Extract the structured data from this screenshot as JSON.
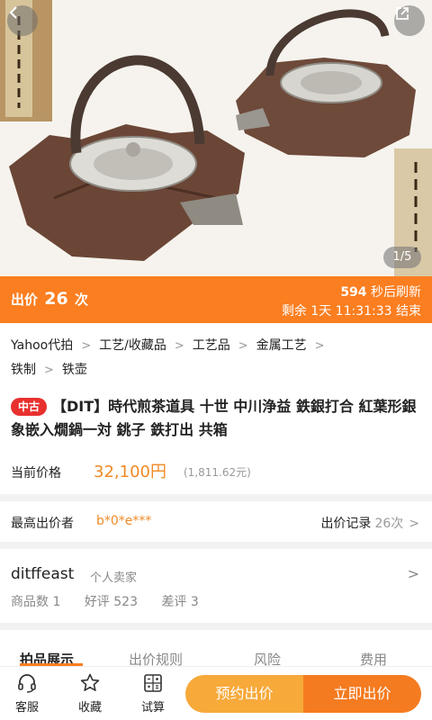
{
  "hero": {
    "pager": "1/5"
  },
  "bid_bar": {
    "prefix": "出价",
    "count": "26",
    "suffix": "次",
    "refresh_seconds": "594",
    "refresh_text": "秒后刷新",
    "remaining": "剩余 1天 11:31:33 结束"
  },
  "breadcrumb": [
    "Yahoo代拍",
    "工艺/收藏品",
    "工艺品",
    "金属工艺",
    "铁制",
    "铁壶"
  ],
  "product": {
    "condition_tag": "中古",
    "title": "【DIT】時代煎茶道具 十世 中川浄益 鉄銀打合 紅葉形銀象嵌入燗鍋一対 銚子 鉄打出 共箱",
    "price_label": "当前价格",
    "price": "32,100円",
    "price_converted": "(1,811.62元)"
  },
  "bidder": {
    "label": "最高出价者",
    "name": "b*0*e***",
    "record_label": "出价记录",
    "record_count": "26次"
  },
  "seller": {
    "name": "ditffeast",
    "type": "个人卖家",
    "items": "商品数 1",
    "good": "好评 523",
    "bad": "差评 3"
  },
  "tabs": [
    "拍品展示",
    "出价规则",
    "风险",
    "费用"
  ],
  "bottom": {
    "service": "客服",
    "favorite": "收藏",
    "calc": "试算",
    "reserve_bid": "预约出价",
    "bid_now": "立即出价"
  },
  "colors": {
    "accent": "#fb7e20",
    "price": "#f08a24",
    "tag": "#e8312f",
    "reserve": "#f7a93a"
  }
}
